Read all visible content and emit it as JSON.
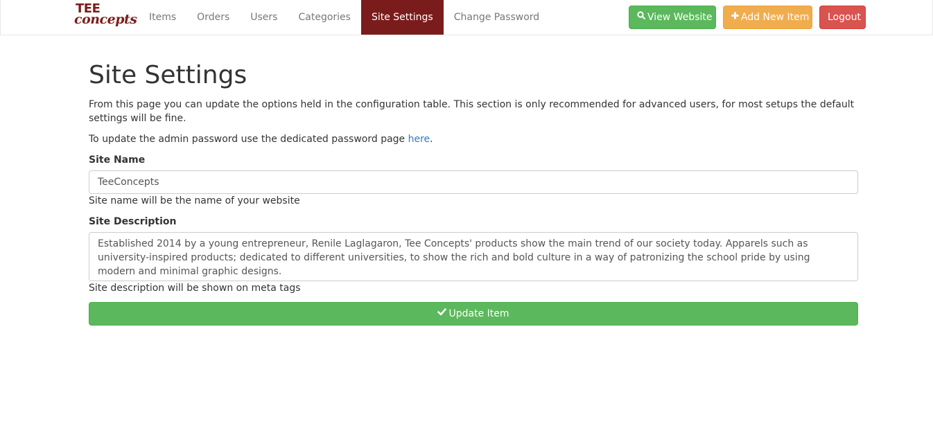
{
  "brand": {
    "line1": "TEE",
    "line2": "concepts"
  },
  "nav": {
    "items": [
      {
        "label": "Items"
      },
      {
        "label": "Orders"
      },
      {
        "label": "Users"
      },
      {
        "label": "Categories"
      },
      {
        "label": "Site Settings",
        "active": true
      },
      {
        "label": "Change Password"
      }
    ],
    "view_website": "View Website",
    "add_new_item": "Add New Item",
    "logout": "Logout"
  },
  "page": {
    "title": "Site Settings",
    "intro": "From this page you can update the options held in the configuration table. This section is only recommended for advanced users, for most setups the default settings will be fine.",
    "password_note_prefix": "To update the admin password use the dedicated password page ",
    "password_link": "here",
    "password_note_suffix": "."
  },
  "form": {
    "site_name_label": "Site Name",
    "site_name_value": "TeeConcepts",
    "site_name_help": "Site name will be the name of your website",
    "site_description_label": "Site Description",
    "site_description_value": "Established 2014 by a young entrepreneur, Renile Laglagaron, Tee Concepts' products show the main trend of our society today. Apparels such as university-inspired products; dedicated to different universities, to show the rich and bold culture in a way of patronizing the school pride by using modern and minimal graphic designs.",
    "site_description_help": "Site description will be shown on meta tags",
    "update_button": "Update Item"
  },
  "colors": {
    "brand": "#7b1c1c",
    "success": "#5cb85c",
    "warning": "#f0ad4e",
    "danger": "#d9534f",
    "link": "#337ab7"
  },
  "icons": {
    "view_website": "search-icon",
    "add_new_item": "plus-icon",
    "update": "check-icon"
  }
}
